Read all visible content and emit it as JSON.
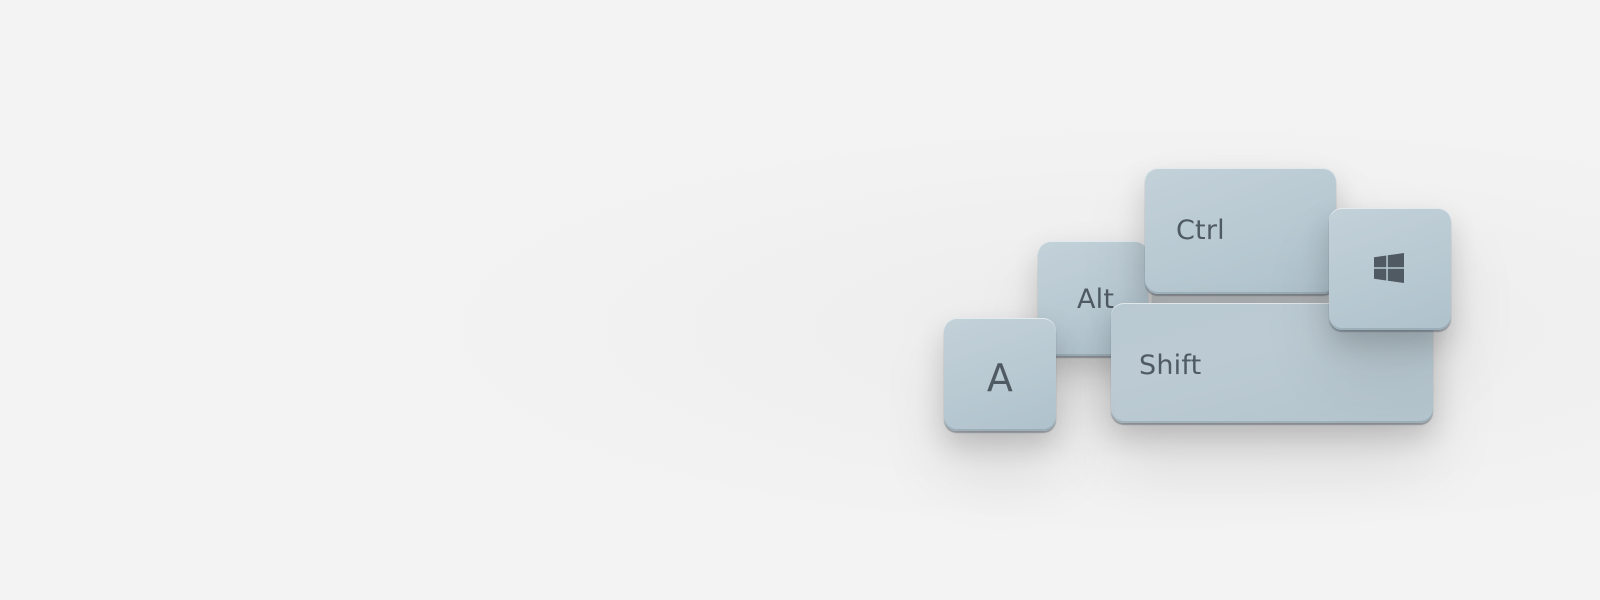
{
  "keycaps": {
    "a": {
      "label": "A"
    },
    "alt": {
      "label": "Alt"
    },
    "ctrl": {
      "label": "Ctrl"
    },
    "shift": {
      "label": "Shift"
    },
    "windows": {
      "icon": "windows-logo-icon"
    }
  },
  "colors": {
    "background": "#f3f3f3",
    "keycap": "#b8c9d2",
    "label": "#4f5a62"
  }
}
